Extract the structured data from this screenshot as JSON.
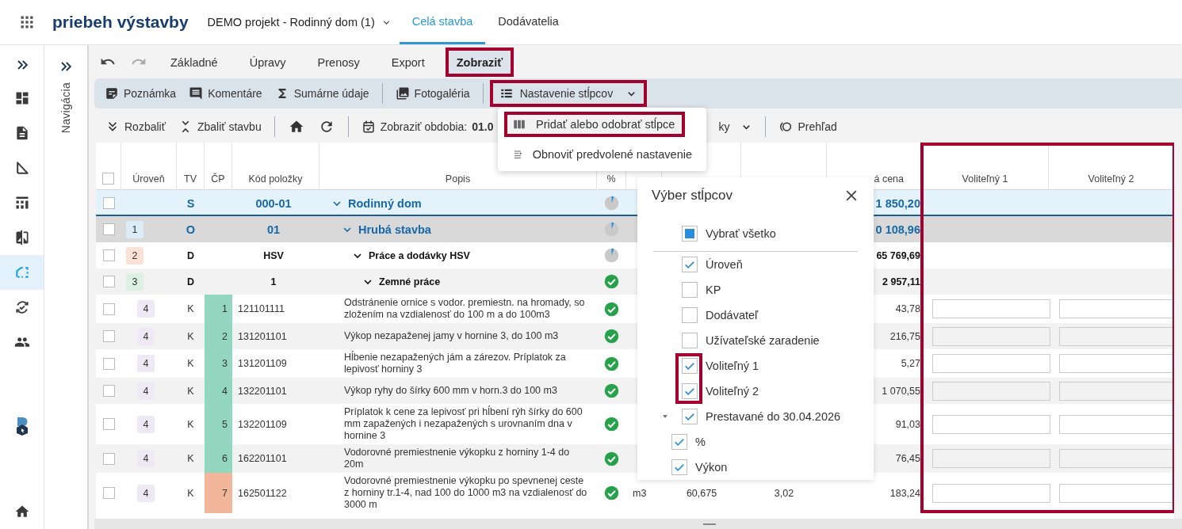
{
  "app_bar": {
    "title": "priebeh výstavby",
    "project": "DEMO projekt - Rodinný dom (1)",
    "tabs": [
      {
        "label": "Celá stavba",
        "selected": true
      },
      {
        "label": "Dodávatelia",
        "selected": false
      }
    ]
  },
  "sidebar": {
    "items": [
      {
        "selected": false
      },
      {
        "selected": false
      },
      {
        "selected": false
      },
      {
        "selected": false
      },
      {
        "selected": false
      },
      {
        "selected": true
      },
      {
        "selected": false
      },
      {
        "selected": false
      },
      {
        "selected": false
      }
    ]
  },
  "navigation_panel": {
    "label": "Navigácia"
  },
  "ribbon": {
    "tabs": [
      {
        "label": "Základné",
        "selected": false,
        "highlighted": false
      },
      {
        "label": "Úpravy",
        "selected": false,
        "highlighted": false
      },
      {
        "label": "Prenosy",
        "selected": false,
        "highlighted": false
      },
      {
        "label": "Export",
        "selected": false,
        "highlighted": false
      },
      {
        "label": "Zobraziť",
        "selected": true,
        "highlighted": true
      }
    ],
    "toolbar": [
      [
        {
          "label": "Poznámka",
          "highlighted": false
        },
        {
          "label": "Komentáre",
          "highlighted": false
        },
        {
          "label": "Sumárne údaje",
          "highlighted": false
        }
      ],
      [
        {
          "label": "Fotogaléria",
          "highlighted": false
        }
      ],
      [
        {
          "label": "Nastavenie stĺpcov",
          "highlighted": true
        }
      ]
    ],
    "toolbar_2": {
      "expand": "Rozbaliť",
      "collapse": "Zbaliť stavbu",
      "period": "Zobraziť obdobia: **01.0**",
      "column_9_dropdown": "ky",
      "overview": "Prehľad"
    }
  },
  "column_menu": {
    "items": [
      {
        "label": "Pridať alebo odobrať stĺpce",
        "highlighted": true
      },
      {
        "label": "Obnoviť predvolené nastavenie",
        "highlighted": false
      }
    ]
  },
  "table": {
    "header_checked": false,
    "columns": [
      {
        "label": "Úroveň",
        "highlighted": false
      },
      {
        "label": "TV",
        "highlighted": false
      },
      {
        "label": "ČP",
        "highlighted": false
      },
      {
        "label": "Kód položky",
        "highlighted": false
      },
      {
        "label": "Popis",
        "highlighted": false
      },
      {
        "label": "%",
        "highlighted": false
      },
      {
        "label": "á cena",
        "highlighted": false
      },
      {
        "label": "Voliteľný 1",
        "highlighted": true
      },
      {
        "label": "Voliteľný 2",
        "highlighted": true
      }
    ],
    "rows": [
      {
        "kind": "root",
        "checked": false,
        "tv": "S",
        "code": "000-01",
        "description": "Rodinný dom",
        "complete": false,
        "total": "1 850,20",
        "children": [
          {
            "kind": "object",
            "checked": false,
            "badge": {
              "text": "1",
              "color": "#dcedf8"
            },
            "tv": "O",
            "code": "01",
            "description": "Hrubá stavba",
            "complete": false,
            "total": "0 108,96",
            "children": [
              {
                "kind": "section",
                "checked": false,
                "badge": {
                  "text": "2",
                  "color": "#fbe1d7"
                },
                "tv": "D",
                "code": "HSV",
                "description": "Práce a dodávky HSV",
                "complete": false,
                "total": "65 769,69",
                "children": [
                  {
                    "kind": "section",
                    "checked": false,
                    "badge": {
                      "text": "3",
                      "color": "#dcf1e2"
                    },
                    "tv": "D",
                    "code": "1",
                    "description": "Zemné práce",
                    "complete": true,
                    "total": "2 957,11",
                    "children": [
                      {
                        "kind": "item",
                        "checked": false,
                        "badge": {
                          "text": "4",
                          "color": "#efe8f5"
                        },
                        "tv": "K",
                        "order": {
                          "text": "1",
                          "color": "#93d7c0"
                        },
                        "code": "121101111",
                        "description": "Odstránenie ornice s vodor. premiestn. na hromady, so zložením na vzdialenosť do 100 m a do 100m3",
                        "complete": true,
                        "total": "43,78"
                      },
                      {
                        "kind": "item",
                        "checked": false,
                        "badge": {
                          "text": "4",
                          "color": "#efe8f5"
                        },
                        "tv": "K",
                        "order": {
                          "text": "2",
                          "color": "#93d7c0"
                        },
                        "code": "131201101",
                        "description": "Výkop nezapaženej jamy v hornine 3, do 100 m3",
                        "complete": true,
                        "total": "216,75"
                      },
                      {
                        "kind": "item",
                        "checked": false,
                        "badge": {
                          "text": "4",
                          "color": "#efe8f5"
                        },
                        "tv": "K",
                        "order": {
                          "text": "3",
                          "color": "#93d7c0"
                        },
                        "code": "131201109",
                        "description": "Hĺbenie nezapažených jám a zárezov. Príplatok za lepivosť horniny 3",
                        "complete": true,
                        "total": "5,27"
                      },
                      {
                        "kind": "item",
                        "checked": false,
                        "badge": {
                          "text": "4",
                          "color": "#efe8f5"
                        },
                        "tv": "K",
                        "order": {
                          "text": "4",
                          "color": "#93d7c0"
                        },
                        "code": "132201101",
                        "description": "Výkop ryhy do šírky 600 mm v horn.3 do 100 m3",
                        "complete": true,
                        "total": "1 070,55"
                      },
                      {
                        "kind": "item",
                        "checked": false,
                        "badge": {
                          "text": "4",
                          "color": "#efe8f5"
                        },
                        "tv": "K",
                        "order": {
                          "text": "5",
                          "color": "#93d7c0"
                        },
                        "code": "132201109",
                        "description": "Príplatok k cene za lepivosť pri hĺbení rýh šírky do 600 mm zapažených i nezapažených s urovnaním dna v hornine 3",
                        "complete": true,
                        "total": "91,03"
                      },
                      {
                        "kind": "item",
                        "checked": false,
                        "badge": {
                          "text": "4",
                          "color": "#efe8f5"
                        },
                        "tv": "K",
                        "order": {
                          "text": "6",
                          "color": "#93d7c0"
                        },
                        "code": "162201101",
                        "description": "Vodorovné premiestnenie výkopku z horniny 1-4 do 20m",
                        "complete": true,
                        "total": "76,45"
                      },
                      {
                        "kind": "item",
                        "checked": false,
                        "badge": {
                          "text": "4",
                          "color": "#efe8f5"
                        },
                        "tv": "K",
                        "order": {
                          "text": "7",
                          "color": "#f2b69b"
                        },
                        "code": "162501122",
                        "description": "Vodorovné premiestnenie výkopku po spevnenej ceste z horniny tr.1-4, nad 100 do 1000 m3 na vzdialenosť do 3000 m",
                        "complete": true,
                        "unit": "m3",
                        "column_9": "60,675",
                        "column_10": "3,02",
                        "total": "183,24"
                      }
                    ]
                  }
                ]
              }
            ]
          }
        ]
      }
    ]
  },
  "column_picker": {
    "title": "Výber stĺpcov",
    "select_all": {
      "label": "Vybrať všetko",
      "checked": false,
      "indeterminate": true
    },
    "items": [
      {
        "label": "Úroveň",
        "checked": true,
        "highlighted": false
      },
      {
        "label": "KP",
        "checked": false,
        "highlighted": false
      },
      {
        "label": "Dodávateľ",
        "checked": false,
        "highlighted": false
      },
      {
        "label": "Užívateľské zaradenie",
        "checked": false,
        "highlighted": false
      },
      {
        "label": "Voliteľný 1",
        "checked": true,
        "highlighted": true
      },
      {
        "label": "Voliteľný 2",
        "checked": true,
        "highlighted": true
      },
      {
        "label": "Prestavané do 30.04.2026",
        "checked": true,
        "highlighted": false,
        "expanded": true,
        "children": [
          {
            "label": "%",
            "checked": true
          },
          {
            "label": "Výkon",
            "checked": true
          }
        ]
      }
    ]
  }
}
